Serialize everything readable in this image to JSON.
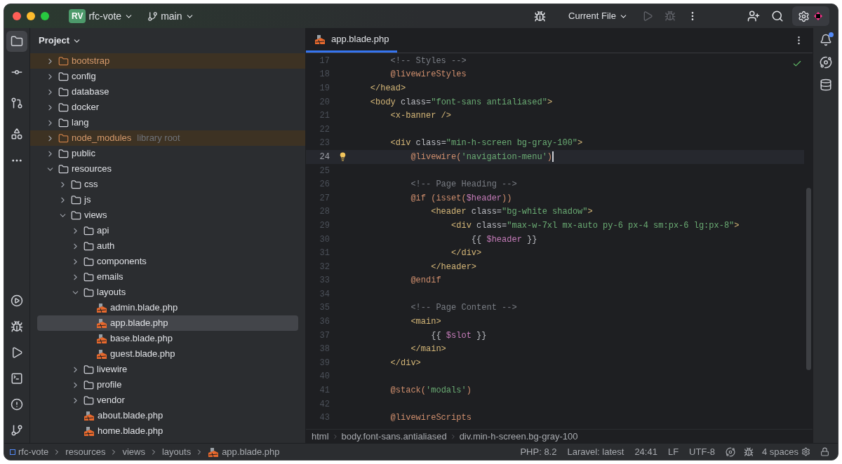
{
  "title_bar": {
    "project_badge": "RV",
    "project": "rfc-vote",
    "branch": "main",
    "run_config": "Current File"
  },
  "tool_strip": [
    {
      "selected": true
    },
    {
      "selected": false
    },
    {
      "selected": false
    },
    {
      "selected": false
    }
  ],
  "project_panel": {
    "title": "Project",
    "tree": [
      {
        "kind": "folder",
        "label": "bootstrap",
        "expanded": false,
        "selected": false,
        "excluded": true
      },
      {
        "kind": "folder",
        "label": "config",
        "expanded": false,
        "selected": false,
        "excluded": false
      },
      {
        "kind": "folder",
        "label": "database",
        "expanded": false,
        "selected": false,
        "excluded": false
      },
      {
        "kind": "folder",
        "label": "docker",
        "expanded": false,
        "selected": false,
        "excluded": false
      },
      {
        "kind": "folder",
        "label": "lang",
        "expanded": false,
        "selected": false,
        "excluded": false
      },
      {
        "kind": "folder",
        "label": "node_modules",
        "note": "library root",
        "expanded": false,
        "selected": false,
        "excluded": true
      },
      {
        "kind": "folder",
        "label": "public",
        "expanded": false,
        "selected": false,
        "excluded": false
      },
      {
        "kind": "folder",
        "label": "resources",
        "expanded": true,
        "selected": false,
        "excluded": false,
        "children": [
          {
            "kind": "folder",
            "label": "css",
            "expanded": false,
            "selected": false,
            "excluded": false
          },
          {
            "kind": "folder",
            "label": "js",
            "expanded": false,
            "selected": false,
            "excluded": false
          },
          {
            "kind": "folder",
            "label": "views",
            "expanded": true,
            "selected": false,
            "excluded": false,
            "children": [
              {
                "kind": "folder",
                "label": "api",
                "expanded": false,
                "selected": false,
                "excluded": false
              },
              {
                "kind": "folder",
                "label": "auth",
                "expanded": false,
                "selected": false,
                "excluded": false
              },
              {
                "kind": "folder",
                "label": "components",
                "expanded": false,
                "selected": false,
                "excluded": false
              },
              {
                "kind": "folder",
                "label": "emails",
                "expanded": false,
                "selected": false,
                "excluded": false
              },
              {
                "kind": "folder",
                "label": "layouts",
                "expanded": true,
                "selected": false,
                "excluded": false,
                "children": [
                  {
                    "kind": "file",
                    "label": "admin.blade.php",
                    "selected": false
                  },
                  {
                    "kind": "file",
                    "label": "app.blade.php",
                    "selected": true
                  },
                  {
                    "kind": "file",
                    "label": "base.blade.php",
                    "selected": false
                  },
                  {
                    "kind": "file",
                    "label": "guest.blade.php",
                    "selected": false
                  }
                ]
              },
              {
                "kind": "folder",
                "label": "livewire",
                "expanded": false,
                "selected": false,
                "excluded": false
              },
              {
                "kind": "folder",
                "label": "profile",
                "expanded": false,
                "selected": false,
                "excluded": false
              },
              {
                "kind": "folder",
                "label": "vendor",
                "expanded": false,
                "selected": false,
                "excluded": false
              },
              {
                "kind": "file",
                "label": "about.blade.php",
                "selected": false
              },
              {
                "kind": "file",
                "label": "home.blade.php",
                "selected": false
              }
            ]
          }
        ]
      }
    ]
  },
  "editor": {
    "tabs": [
      {
        "label": "app.blade.php",
        "selected": true
      }
    ],
    "lines": [
      {
        "number": "17",
        "current": false,
        "tokens": [
          {
            "kind": "comment",
            "text": "        <!-- Styles -->"
          }
        ]
      },
      {
        "number": "18",
        "current": false,
        "tokens": [
          {
            "kind": "directive",
            "text": "        @livewireStyles"
          }
        ]
      },
      {
        "number": "19",
        "current": false,
        "tokens": [
          {
            "kind": "tag",
            "text": "    </head>"
          }
        ]
      },
      {
        "number": "20",
        "current": false,
        "tokens": [
          {
            "kind": "tag",
            "text": "    <body"
          },
          {
            "kind": "attr",
            "text": " class="
          },
          {
            "kind": "string",
            "text": "\"font-sans antialiased\""
          },
          {
            "kind": "tag",
            "text": ">"
          }
        ]
      },
      {
        "number": "21",
        "current": false,
        "tokens": [
          {
            "kind": "tag",
            "text": "        <x-banner />"
          }
        ]
      },
      {
        "number": "22",
        "current": false
      },
      {
        "number": "23",
        "current": false,
        "tokens": [
          {
            "kind": "tag",
            "text": "        <div"
          },
          {
            "kind": "attr",
            "text": " class="
          },
          {
            "kind": "string",
            "text": "\"min-h-screen bg-gray-100\""
          },
          {
            "kind": "tag",
            "text": ">"
          }
        ]
      },
      {
        "number": "24",
        "current": true,
        "tokens": [
          {
            "kind": "directive",
            "text": "            @livewire("
          },
          {
            "kind": "string",
            "text": "'navigation-menu'"
          },
          {
            "kind": "directive",
            "text": ")"
          }
        ]
      },
      {
        "number": "25",
        "current": false
      },
      {
        "number": "26",
        "current": false,
        "tokens": [
          {
            "kind": "comment",
            "text": "            <!-- Page Heading -->"
          }
        ]
      },
      {
        "number": "27",
        "current": false,
        "tokens": [
          {
            "kind": "directive",
            "text": "            @if (isset("
          },
          {
            "kind": "var",
            "text": "$header"
          },
          {
            "kind": "directive",
            "text": "))"
          }
        ]
      },
      {
        "number": "28",
        "current": false,
        "tokens": [
          {
            "kind": "tag",
            "text": "                <header"
          },
          {
            "kind": "attr",
            "text": " class="
          },
          {
            "kind": "string",
            "text": "\"bg-white shadow\""
          },
          {
            "kind": "tag",
            "text": ">"
          }
        ]
      },
      {
        "number": "29",
        "current": false,
        "tokens": [
          {
            "kind": "tag",
            "text": "                    <div"
          },
          {
            "kind": "attr",
            "text": " class="
          },
          {
            "kind": "string",
            "text": "\"max-w-7xl mx-auto py-6 px-4 sm:px-6 lg:px-8\""
          },
          {
            "kind": "tag",
            "text": ">"
          }
        ]
      },
      {
        "number": "30",
        "current": false,
        "tokens": [
          {
            "kind": "plain",
            "text": "                        {{ "
          },
          {
            "kind": "var",
            "text": "$header"
          },
          {
            "kind": "plain",
            "text": " }}"
          }
        ]
      },
      {
        "number": "31",
        "current": false,
        "tokens": [
          {
            "kind": "tag",
            "text": "                    </div>"
          }
        ]
      },
      {
        "number": "32",
        "current": false,
        "tokens": [
          {
            "kind": "tag",
            "text": "                </header>"
          }
        ]
      },
      {
        "number": "33",
        "current": false,
        "tokens": [
          {
            "kind": "directive",
            "text": "            @endif"
          }
        ]
      },
      {
        "number": "34",
        "current": false
      },
      {
        "number": "35",
        "current": false,
        "tokens": [
          {
            "kind": "comment",
            "text": "            <!-- Page Content -->"
          }
        ]
      },
      {
        "number": "36",
        "current": false,
        "tokens": [
          {
            "kind": "tag",
            "text": "            <main>"
          }
        ]
      },
      {
        "number": "37",
        "current": false,
        "tokens": [
          {
            "kind": "plain",
            "text": "                {{ "
          },
          {
            "kind": "var",
            "text": "$slot"
          },
          {
            "kind": "plain",
            "text": " }}"
          }
        ]
      },
      {
        "number": "38",
        "current": false,
        "tokens": [
          {
            "kind": "tag",
            "text": "            </main>"
          }
        ]
      },
      {
        "number": "39",
        "current": false,
        "tokens": [
          {
            "kind": "tag",
            "text": "        </div>"
          }
        ]
      },
      {
        "number": "40",
        "current": false
      },
      {
        "number": "41",
        "current": false,
        "tokens": [
          {
            "kind": "directive",
            "text": "        @stack("
          },
          {
            "kind": "string",
            "text": "'modals'"
          },
          {
            "kind": "directive",
            "text": ")"
          }
        ]
      },
      {
        "number": "42",
        "current": false
      },
      {
        "number": "43",
        "current": false,
        "tokens": [
          {
            "kind": "directive",
            "text": "        @livewireScripts"
          }
        ]
      }
    ],
    "breadcrumbs": [
      "html",
      "body.font-sans.antialiased",
      "div.min-h-screen.bg-gray-100"
    ]
  },
  "status_bar": {
    "path": [
      "rfc-vote",
      "resources",
      "views",
      "layouts",
      "app.blade.php"
    ],
    "items": [
      "PHP: 8.2",
      "Laravel: latest",
      "24:41",
      "LF",
      "UTF-8"
    ],
    "indent": "4 spaces"
  }
}
